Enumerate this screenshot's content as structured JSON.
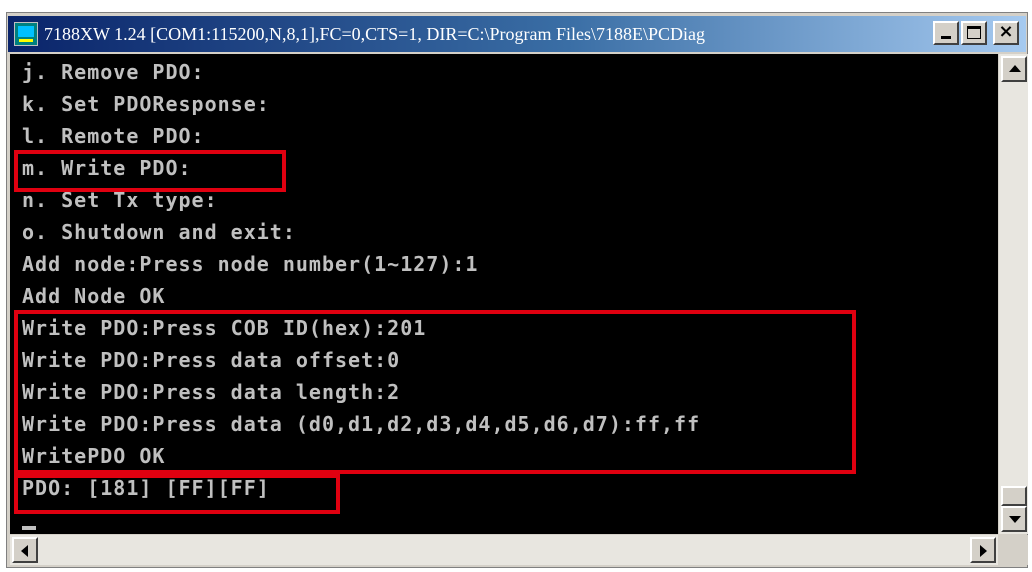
{
  "window": {
    "title": "7188XW 1.24 [COM1:115200,N,8,1],FC=0,CTS=1, DIR=C:\\Program Files\\7188E\\PCDiag",
    "icon": "app-icon",
    "buttons": {
      "minimize": "minimize-icon",
      "maximize": "maximize-icon",
      "close": "close-icon"
    },
    "close_glyph": "×"
  },
  "console": {
    "lines": [
      "j. Remove PDO:",
      "k. Set PDOResponse:",
      "l. Remote PDO:",
      "m. Write PDO:",
      "n. Set Tx type:",
      "o. Shutdown and exit:",
      "Add node:Press node number(1~127):1",
      "Add Node OK",
      "Write PDO:Press COB ID(hex):201",
      "Write PDO:Press data offset:0",
      "Write PDO:Press data length:2",
      "Write PDO:Press data (d0,d1,d2,d3,d4,d5,d6,d7):ff,ff",
      "WritePDO OK",
      "PDO: [181] [FF][FF]"
    ]
  },
  "colors": {
    "highlight": "#e00010",
    "console_bg": "#000000",
    "console_text": "#c0c0c0",
    "titlebar_start": "#0a246a",
    "titlebar_end": "#a6caf0"
  }
}
